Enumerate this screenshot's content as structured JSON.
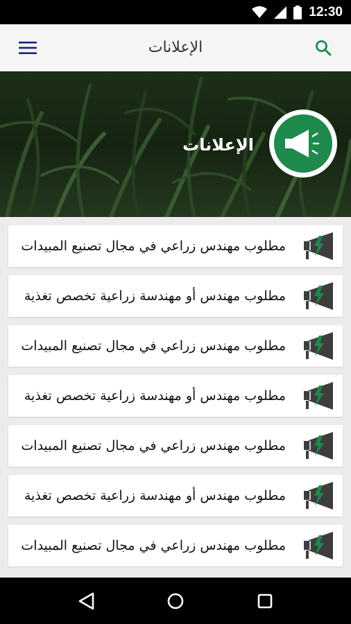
{
  "status_bar": {
    "time": "12:30"
  },
  "app_bar": {
    "title": "الإعلانات"
  },
  "hero": {
    "title": "الإعلانات"
  },
  "announcements": [
    "مطلوب مهندس زراعي في مجال تصنيع المبيدات",
    "مطلوب مهندس أو مهندسة زراعية تخصص تغذية",
    "مطلوب مهندس زراعي في مجال تصنيع المبيدات",
    "مطلوب مهندس أو مهندسة زراعية تخصص تغذية",
    "مطلوب مهندس زراعي في مجال تصنيع المبيدات",
    "مطلوب مهندس أو مهندسة زراعية تخصص تغذية",
    "مطلوب مهندس زراعي في مجال تصنيع المبيدات"
  ],
  "colors": {
    "brand_green": "#1e8a4b",
    "menu_blue": "#1a237e",
    "icon_gray": "#3d3d3d"
  }
}
